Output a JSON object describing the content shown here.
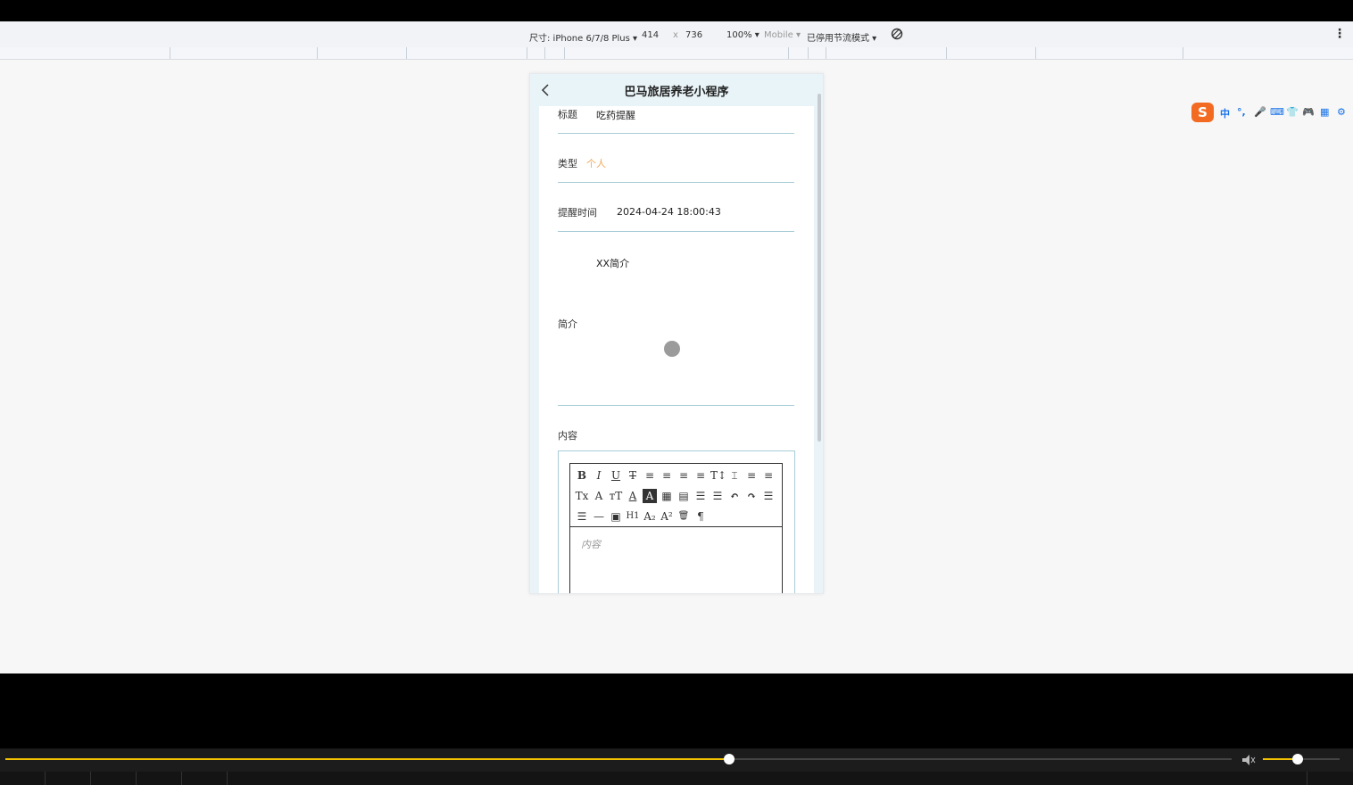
{
  "devtools": {
    "device_label": "尺寸: iPhone 6/7/8 Plus ▾",
    "width": "414",
    "times": "x",
    "height": "736",
    "zoom": "100% ▾",
    "mobile": "Mobile ▾",
    "throttle": "已停用节流模式 ▾",
    "rotate_icon": "rotate-icon",
    "menu_icon": "more-vertical-icon"
  },
  "app": {
    "title": "巴马旅居养老小程序",
    "back_icon": "chevron-left-icon"
  },
  "form": {
    "title_label": "标题",
    "title_value": "吃药提醒",
    "type_label": "类型",
    "type_value": "个人",
    "remind_label": "提醒时间",
    "remind_value": "2024-04-24 18:00:43",
    "intro_value": "XX简介",
    "intro_label": "简介",
    "content_label": "内容",
    "editor_placeholder": "内容"
  },
  "editor_toolbar": {
    "row1": [
      "B",
      "I",
      "U",
      "T",
      "≡",
      "≡",
      "≡",
      "≡",
      "T↕",
      "⌶",
      "≡",
      "≡"
    ],
    "row2": [
      "Tx",
      "A",
      "ᴛT",
      "A",
      "A",
      "▦",
      "▤",
      "☰",
      "☰",
      "↶",
      "↷",
      "☰"
    ],
    "row3": [
      "☰",
      "—",
      "▣",
      "H1",
      "A₂",
      "A²",
      "🗑",
      "¶"
    ]
  },
  "ime": {
    "logo": "S",
    "items": [
      "中",
      "°,",
      "🎤",
      "⌨",
      "👕",
      "🎮",
      "▦",
      "⚙"
    ]
  },
  "player": {
    "progress": 0.59,
    "volume": 0.45,
    "accent": "#f2c200"
  }
}
